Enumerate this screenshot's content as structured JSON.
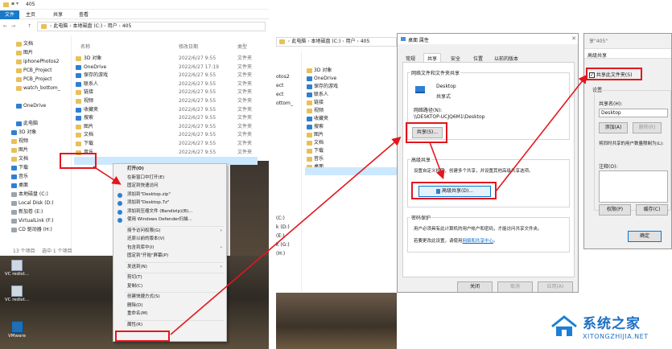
{
  "explorer1": {
    "title": "405",
    "ribbon_tabs": [
      "文件",
      "主页",
      "共享",
      "查看"
    ],
    "path": [
      "此电脑",
      "本地磁盘 (C:)",
      "用户",
      "405"
    ],
    "columns": [
      "名称",
      "修改日期",
      "类型"
    ],
    "files": [
      {
        "name": "3D 对象",
        "date": "2022/6/27 9:55",
        "type": "文件夹"
      },
      {
        "name": "OneDrive",
        "date": "2022/6/27 17:19",
        "type": "文件夹"
      },
      {
        "name": "保存的游戏",
        "date": "2022/6/27 9:55",
        "type": "文件夹"
      },
      {
        "name": "联系人",
        "date": "2022/6/27 9:55",
        "type": "文件夹"
      },
      {
        "name": "链接",
        "date": "2022/6/27 9:55",
        "type": "文件夹"
      },
      {
        "name": "视频",
        "date": "2022/6/27 9:55",
        "type": "文件夹"
      },
      {
        "name": "收藏夹",
        "date": "2022/6/27 9:55",
        "type": "文件夹"
      },
      {
        "name": "搜索",
        "date": "2022/6/27 9:55",
        "type": "文件夹"
      },
      {
        "name": "图片",
        "date": "2022/6/27 9:55",
        "type": "文件夹"
      },
      {
        "name": "文档",
        "date": "2022/6/27 9:55",
        "type": "文件夹"
      },
      {
        "name": "下载",
        "date": "2022/6/27 9:55",
        "type": "文件夹"
      },
      {
        "name": "音乐",
        "date": "2022/6/27 9:55",
        "type": "文件夹"
      },
      {
        "name": "桌面",
        "date": "2022/6/27 9:55",
        "type": "文件夹"
      }
    ],
    "sidebar": [
      {
        "name": "文档",
        "kind": "folder"
      },
      {
        "name": "图片",
        "kind": "folder"
      },
      {
        "name": "iphonePhotos2",
        "kind": "folder"
      },
      {
        "name": "PCB_Project",
        "kind": "folder"
      },
      {
        "name": "PCB_Project",
        "kind": "folder"
      },
      {
        "name": "watch_bottom_",
        "kind": "folder"
      },
      {
        "name": "",
        "kind": "gap"
      },
      {
        "name": "OneDrive",
        "kind": "blue"
      },
      {
        "name": "",
        "kind": "gap"
      },
      {
        "name": "此电脑",
        "kind": "blue"
      },
      {
        "name": "3D 对象",
        "kind": "blue"
      },
      {
        "name": "视频",
        "kind": "folder"
      },
      {
        "name": "图片",
        "kind": "folder"
      },
      {
        "name": "文档",
        "kind": "folder"
      },
      {
        "name": "下载",
        "kind": "blue"
      },
      {
        "name": "音乐",
        "kind": "blue"
      },
      {
        "name": "桌面",
        "kind": "blue"
      },
      {
        "name": "本地磁盘 (C:)",
        "kind": "drive"
      },
      {
        "name": "Local Disk (D:)",
        "kind": "drive"
      },
      {
        "name": "新加卷 (E:)",
        "kind": "drive"
      },
      {
        "name": "VirtualLink (F:)",
        "kind": "drive"
      },
      {
        "name": "CD 驱动器 (H:)",
        "kind": "drive"
      }
    ],
    "status": [
      "13 个项目",
      "选中 1 个项目"
    ]
  },
  "context_menu": {
    "items": [
      {
        "label": "打开(O)",
        "bold": true
      },
      {
        "label": "在新窗口中打开(E)"
      },
      {
        "label": "固定到快速访问"
      },
      {
        "label": "添加到\"Desktop.zip\"",
        "icon": true
      },
      {
        "label": "添加到\"Desktop.7z\"",
        "icon": true
      },
      {
        "label": "添加到压缩文件 (Bandizip)(B)...",
        "icon": true
      },
      {
        "label": "使用 Windows Defender扫描...",
        "icon": true,
        "sep_after": true
      },
      {
        "label": "授予访问权限(G)",
        "arrow": true
      },
      {
        "label": "还原以前的版本(V)"
      },
      {
        "label": "包含到库中(I)",
        "arrow": true
      },
      {
        "label": "固定到\"开始\"屏幕(P)",
        "sep_after": true
      },
      {
        "label": "发送到(N)",
        "arrow": true,
        "sep_after": true
      },
      {
        "label": "剪切(T)"
      },
      {
        "label": "复制(C)",
        "sep_after": true
      },
      {
        "label": "创建快捷方式(S)"
      },
      {
        "label": "删除(D)"
      },
      {
        "label": "重命名(M)",
        "sep_after": true
      },
      {
        "label": "属性(R)",
        "highlight": true
      }
    ]
  },
  "desktop_icons": [
    {
      "label": "VC redist..."
    },
    {
      "label": "VC redist..."
    },
    {
      "label": "VMware"
    }
  ],
  "explorer2": {
    "path": [
      "此电脑",
      "本地磁盘 (C:)",
      "用户",
      "405"
    ],
    "files": [
      "3D 对象",
      "OneDrive",
      "保存的游戏",
      "联系人",
      "链接",
      "视频",
      "收藏夹",
      "搜索",
      "图片",
      "文档",
      "下载",
      "音乐",
      "桌面"
    ],
    "left_partial": [
      "otos2",
      "ect",
      "ect",
      "ottom_"
    ],
    "drives_partial": [
      "(C:)",
      "k (D:)",
      "(E:)",
      "k (G:)",
      "(H:)"
    ]
  },
  "props_dialog": {
    "title": "桌面 属性",
    "tabs": [
      "常规",
      "共享",
      "安全",
      "位置",
      "以前的版本"
    ],
    "share_group_title": "网络文件和文件夹共享",
    "folder_name": "Desktop",
    "share_state": "共享式",
    "net_path_label": "网络路径(N):",
    "net_path": "\\\\DESKTOP-UCJQ6M1\\Desktop",
    "share_button": "共享(S)...",
    "adv_group_title": "高级共享",
    "adv_desc": "设置自定义权限，创建多个共享，并设置其他高级共享选项。",
    "adv_button": "高级共享(D)...",
    "pwd_group_title": "密码保护",
    "pwd_desc": "用户必须具有此计算机的用户帐户和密码，才能访问共享文件夹。",
    "pwd_link_prefix": "若要更改此设置，请使用",
    "pwd_link": "网络和共享中心",
    "pwd_link_suffix": "。",
    "buttons": [
      "关闭",
      "取消",
      "应用(A)"
    ]
  },
  "adv_dialog": {
    "title_right": "享\"405\"",
    "title": "高级共享",
    "checkbox_label": "共享此文件夹(S)",
    "settings_label": "设置",
    "share_name_label": "共享名(H):",
    "share_name": "Desktop",
    "add_button": "添加(A)",
    "remove_button": "删除(R)",
    "limit_label": "将同时共享的用户数量限制为(L):",
    "comment_label": "注释(O):",
    "permissions_button": "权限(P)",
    "cache_button": "缓存(C)",
    "ok_button": "确定"
  },
  "watermark": {
    "brand": "系统之家",
    "url": "XITONGZHIJIA.NET"
  },
  "colors": {
    "highlight_red": "#e3161e",
    "accent_blue": "#2f7fd3",
    "ribbon_blue": "#1979ca",
    "folder_yellow": "#e8c05a"
  }
}
